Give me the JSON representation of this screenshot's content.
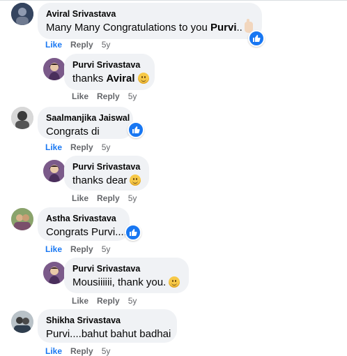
{
  "colors": {
    "bubble": "#f0f2f5",
    "accent": "#1877f2",
    "muted": "#65676b"
  },
  "comments": [
    {
      "author": "Aviral Srivastava",
      "text": "Many Many Congratulations to you ",
      "bold": "Purvi",
      "suffix": "..",
      "emoji": "hand",
      "like": "Like",
      "reply": "Reply",
      "time": "5y"
    },
    {
      "author": "Purvi Srivastava",
      "text": "thanks ",
      "bold": "Aviral",
      "emoji": "smile",
      "like": "Like",
      "reply": "Reply",
      "time": "5y"
    },
    {
      "author": "Saalmanjika Jaiswal",
      "text": "Congrats di",
      "like": "Like",
      "reply": "Reply",
      "time": "5y"
    },
    {
      "author": "Purvi Srivastava",
      "text": "thanks dear",
      "emoji": "smile",
      "like": "Like",
      "reply": "Reply",
      "time": "5y"
    },
    {
      "author": "Astha Srivastava",
      "text": "Congrats Purvi....",
      "like": "Like",
      "reply": "Reply",
      "time": "5y"
    },
    {
      "author": "Purvi Srivastava",
      "text": "Mousiiiiii, thank you.",
      "emoji": "smile",
      "like": "Like",
      "reply": "Reply",
      "time": "5y"
    },
    {
      "author": "Shikha Srivastava",
      "text": "Purvi....bahut bahut badhai",
      "like": "Like",
      "reply": "Reply",
      "time": "5y"
    }
  ]
}
